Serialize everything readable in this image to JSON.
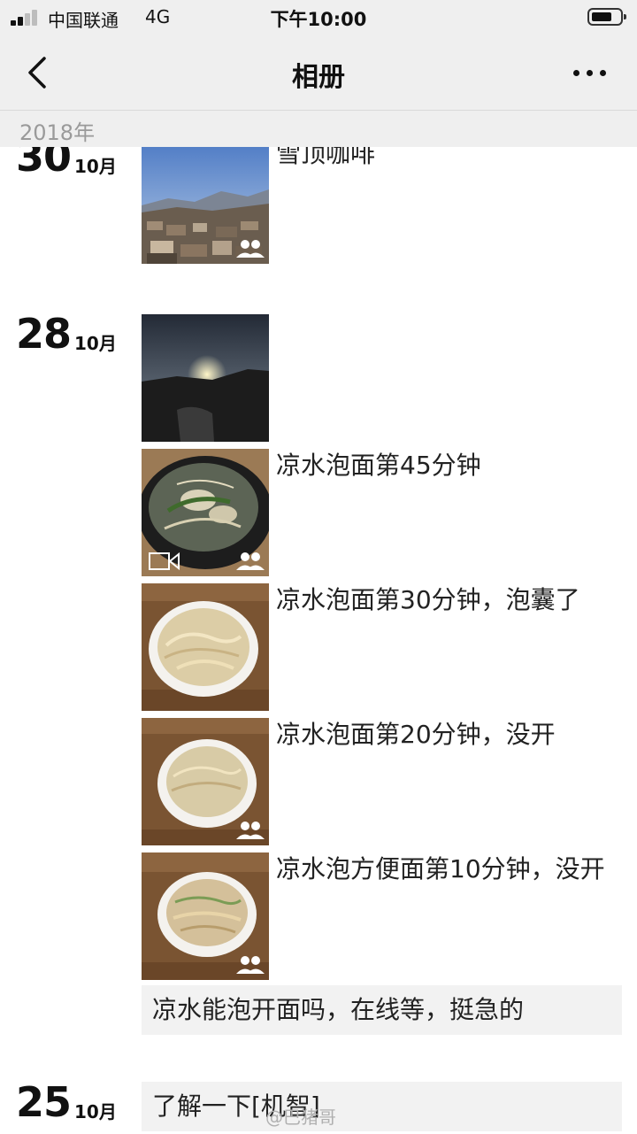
{
  "status_bar": {
    "carrier": "中国联通",
    "network": "4G",
    "time": "下午10:00"
  },
  "nav": {
    "title": "相册",
    "back_icon": "chevron-left-icon",
    "more_icon": "more-dots-icon"
  },
  "year_header": "2018年",
  "groups": [
    {
      "day": "30",
      "month": "10月",
      "posts": [
        {
          "caption": "雪顶咖啡",
          "thumb": "mountain-town-photo",
          "badge": "friends-icon"
        }
      ]
    },
    {
      "day": "28",
      "month": "10月",
      "posts": [
        {
          "caption": "",
          "thumb": "sunset-photo"
        },
        {
          "caption": "凉水泡面第45分钟",
          "thumb": "noodle-pot-photo",
          "badges": [
            "video-icon",
            "friends-icon"
          ]
        },
        {
          "caption": "凉水泡面第30分钟，泡囊了",
          "thumb": "noodle-bowl-photo"
        },
        {
          "caption": "凉水泡面第20分钟，没开",
          "thumb": "noodle-bowl-photo",
          "badge": "friends-icon"
        },
        {
          "caption": "凉水泡方便面第10分钟，没开",
          "thumb": "noodle-bowl-photo",
          "badge": "friends-icon"
        }
      ],
      "text_post": "凉水能泡开面吗，在线等，挺急的"
    },
    {
      "day": "25",
      "month": "10月",
      "text_post": "了解一下[机智]"
    }
  ],
  "watermark": "@巴猪哥",
  "colors": {
    "bar_background": "#efefef",
    "card_background": "#f2f2f2",
    "year_text": "#9a9a9a"
  }
}
